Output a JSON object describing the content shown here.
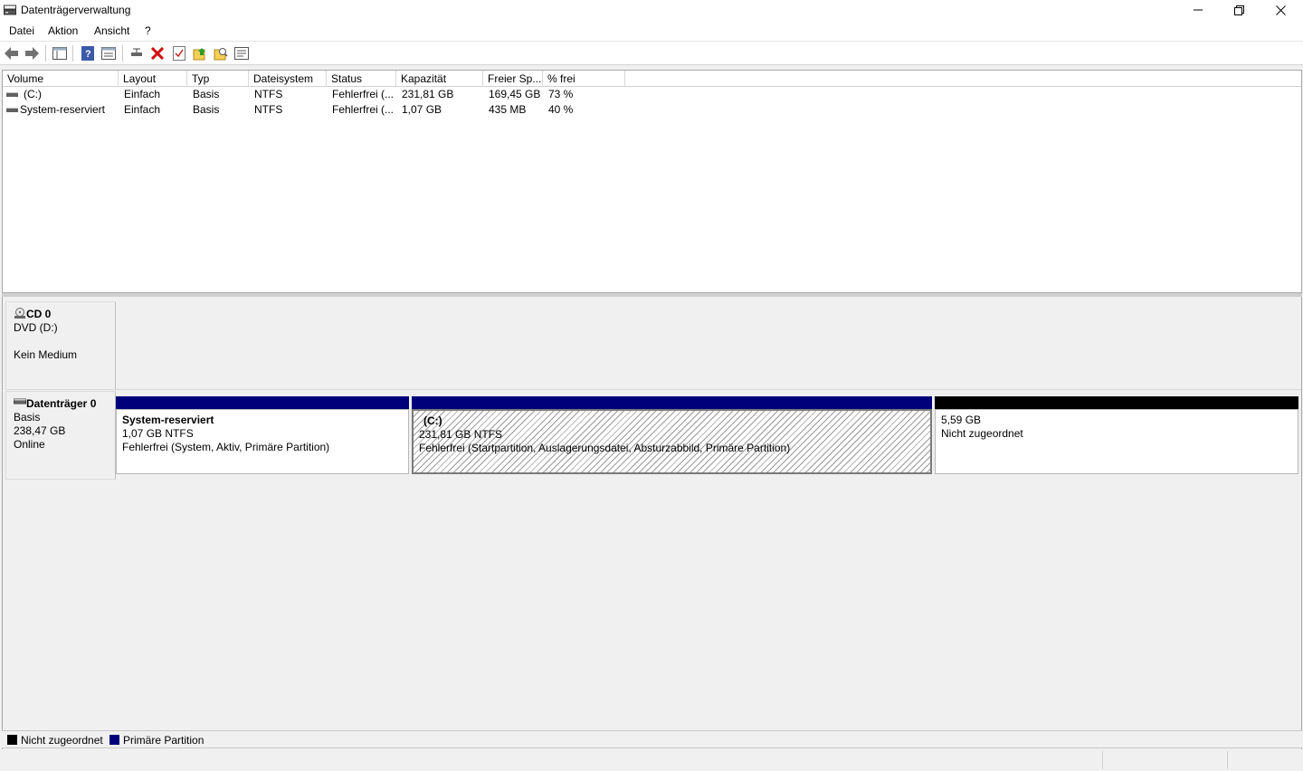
{
  "window": {
    "title": "Datenträgerverwaltung"
  },
  "menu": {
    "items": [
      "Datei",
      "Aktion",
      "Ansicht",
      "?"
    ]
  },
  "toolbar": {
    "buttons": [
      "back-icon",
      "forward-icon",
      "console-tree-icon",
      "help-icon",
      "properties-icon",
      "connect-disk-icon",
      "delete-icon",
      "check-icon",
      "folder-up-icon",
      "search-folder-icon",
      "list-view-icon"
    ]
  },
  "volume_list": {
    "columns": [
      "Volume",
      "Layout",
      "Typ",
      "Dateisystem",
      "Status",
      "Kapazität",
      "Freier Sp...",
      "% frei"
    ],
    "rows": [
      {
        "volume": "(C:)",
        "layout": "Einfach",
        "typ": "Basis",
        "fs": "NTFS",
        "status": "Fehlerfrei (...",
        "capacity": "231,81 GB",
        "free": "169,45 GB",
        "pct": "73 %"
      },
      {
        "volume": "System-reserviert",
        "layout": "Einfach",
        "typ": "Basis",
        "fs": "NTFS",
        "status": "Fehlerfrei (...",
        "capacity": "1,07 GB",
        "free": "435 MB",
        "pct": "40 %"
      }
    ]
  },
  "disks": {
    "cd0": {
      "name": "CD 0",
      "type": "DVD (D:)",
      "status": "Kein Medium"
    },
    "disk0": {
      "name": "Datenträger 0",
      "type": "Basis",
      "size": "238,47 GB",
      "status": "Online",
      "partitions": [
        {
          "name": "System-reserviert",
          "size": "1,07 GB NTFS",
          "status": "Fehlerfrei (System, Aktiv, Primäre Partition)"
        },
        {
          "name": "(C:)",
          "size": "231,81 GB NTFS",
          "status": "Fehlerfrei (Startpartition, Auslagerungsdatei, Absturzabbild, Primäre Partition)"
        },
        {
          "name": "",
          "size": "5,59 GB",
          "status": "Nicht zugeordnet"
        }
      ]
    }
  },
  "legend": {
    "unallocated": "Nicht zugeordnet",
    "primary": "Primäre Partition"
  },
  "colors": {
    "primary": "#00007a",
    "unallocated": "#000000"
  }
}
